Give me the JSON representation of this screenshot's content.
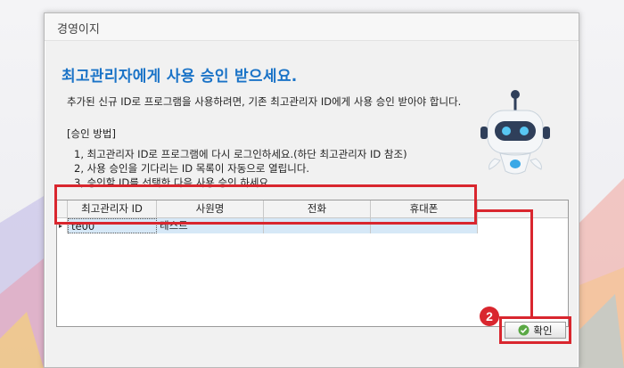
{
  "window": {
    "title": "경영이지"
  },
  "main": {
    "heading": "최고관리자에게 사용 승인 받으세요.",
    "subline": "추가된 신규 ID로 프로그램을 사용하려면, 기존 최고관리자 ID에게 사용 승인 받아야 합니다.",
    "method_title": "[승인 방법]",
    "steps": [
      "1, 최고관리자 ID로 프로그램에 다시 로그인하세요.(하단 최고관리자 ID 참조)",
      "2, 사용 승인을 기다리는 ID 목록이 자동으로 열립니다.",
      "3, 승인할 ID를 선택한 다음 사용 승인 하세요."
    ]
  },
  "grid": {
    "columns": [
      "최고관리자 ID",
      "사원명",
      "전화",
      "휴대폰"
    ],
    "rows": [
      {
        "indicator": "▸",
        "cells": [
          "te00",
          "테스트",
          "",
          ""
        ]
      }
    ]
  },
  "annotation": {
    "badge": "2"
  },
  "footer": {
    "ok_label": "확인"
  },
  "colors": {
    "heading": "#1a73c7",
    "highlight": "#d9262e",
    "row_selected": "#d6e8f7"
  },
  "icons": {
    "ok": "check-circle-icon",
    "mascot": "robot-icon"
  }
}
